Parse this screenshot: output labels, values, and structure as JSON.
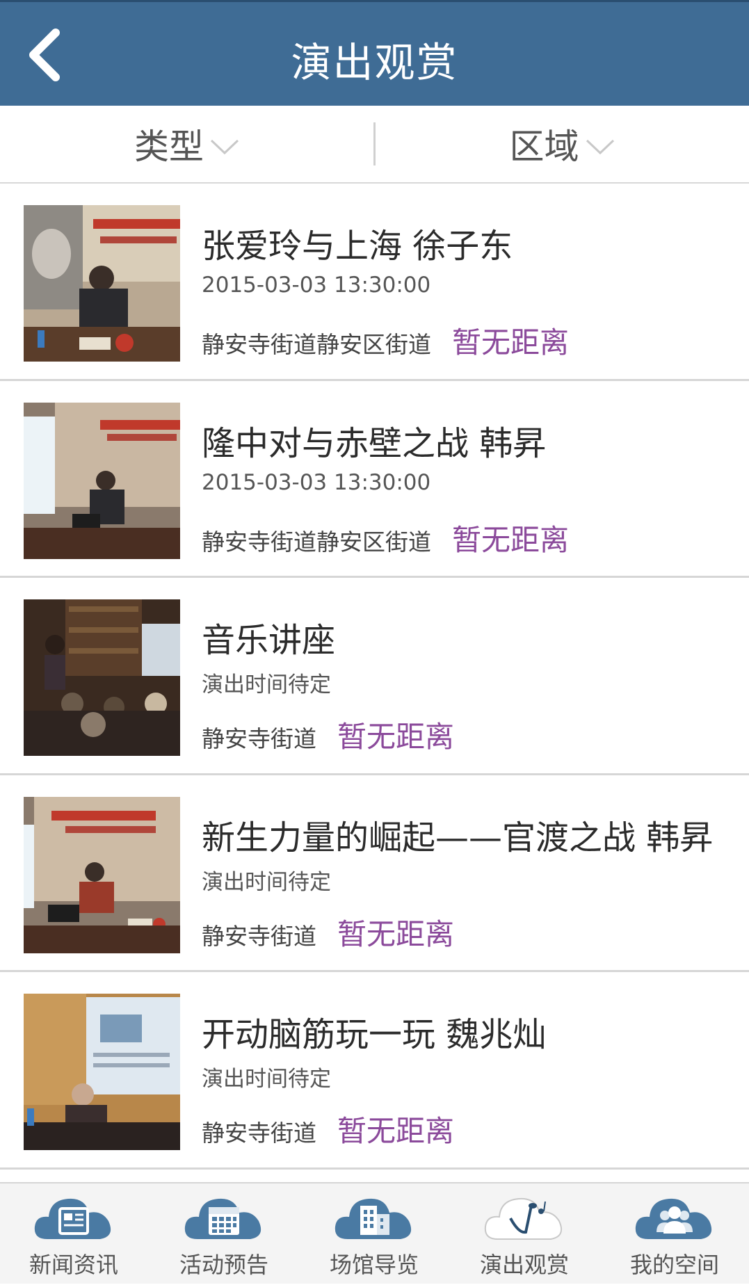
{
  "header": {
    "title": "演出观赏",
    "back_icon": "chevron-left-icon"
  },
  "filters": {
    "type_label": "类型",
    "area_label": "区域"
  },
  "items": [
    {
      "title": "张爱玲与上海 徐子东",
      "time": "2015-03-03 13:30:00",
      "location": "静安寺街道静安区街道",
      "distance": "暂无距离"
    },
    {
      "title": "隆中对与赤壁之战 韩昇",
      "time": "2015-03-03 13:30:00",
      "location": "静安寺街道静安区街道",
      "distance": "暂无距离"
    },
    {
      "title": "音乐讲座",
      "time": "演出时间待定",
      "location": "静安寺街道",
      "distance": "暂无距离"
    },
    {
      "title": "新生力量的崛起——官渡之战 韩昇",
      "time": "演出时间待定",
      "location": "静安寺街道",
      "distance": "暂无距离"
    },
    {
      "title": "开动脑筋玩一玩 魏兆灿",
      "time": "演出时间待定",
      "location": "静安寺街道",
      "distance": "暂无距离"
    }
  ],
  "nav": [
    {
      "label": "新闻资讯",
      "icon": "newspaper-icon",
      "active": false
    },
    {
      "label": "活动预告",
      "icon": "calendar-icon",
      "active": false
    },
    {
      "label": "场馆导览",
      "icon": "building-icon",
      "active": false
    },
    {
      "label": "演出观赏",
      "icon": "music-note-icon",
      "active": true
    },
    {
      "label": "我的空间",
      "icon": "users-icon",
      "active": false
    }
  ],
  "colors": {
    "header": "#3f6c95",
    "distance": "#8b4a9b",
    "nav_cloud": "#4a7aa3",
    "nav_active": "#ffffff"
  }
}
